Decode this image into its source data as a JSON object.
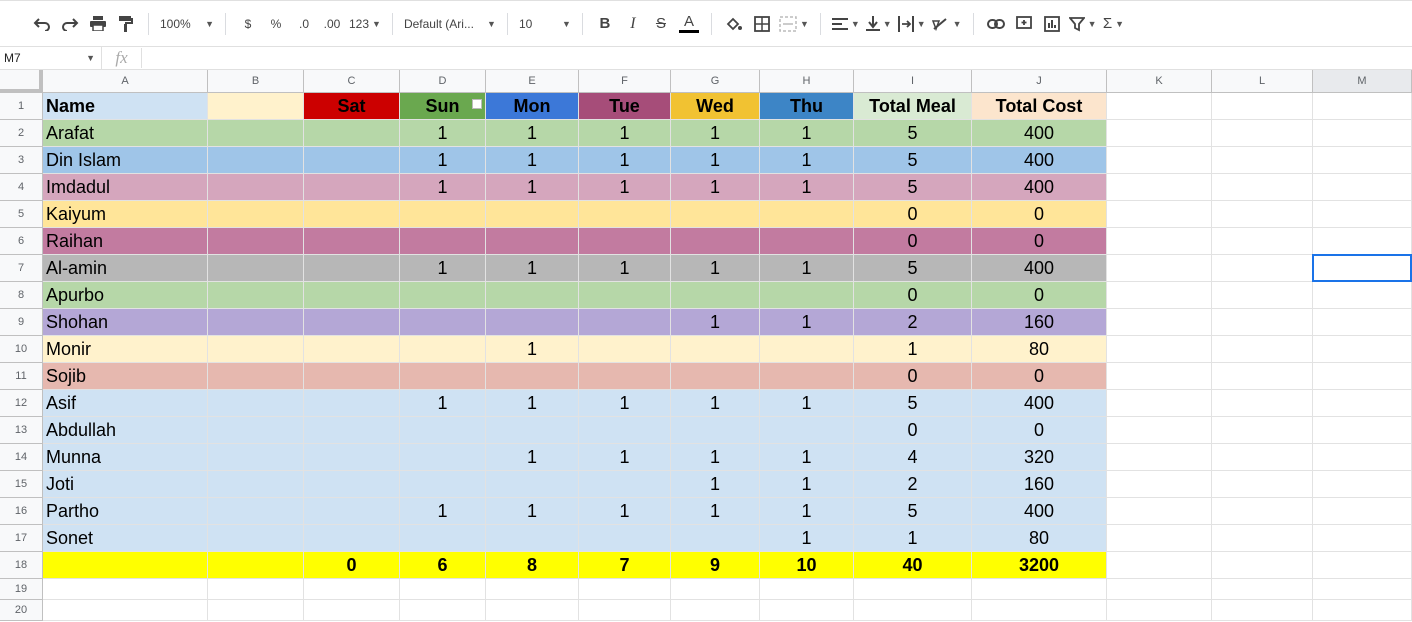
{
  "toolbar": {
    "zoom": "100%",
    "currency": "$",
    "percent": "%",
    "dec_decrease": ".0",
    "dec_increase": ".00",
    "more_formats": "123",
    "font": "Default (Ari...",
    "font_size": "10",
    "bold": "B",
    "italic": "I",
    "strike": "S",
    "text_color": "A",
    "sum": "Σ"
  },
  "formula_bar": {
    "name_box": "M7",
    "fx": "fx",
    "value": ""
  },
  "columns": [
    "A",
    "B",
    "C",
    "D",
    "E",
    "F",
    "G",
    "H",
    "I",
    "J",
    "K",
    "L",
    "M"
  ],
  "rows": [
    "1",
    "2",
    "3",
    "4",
    "5",
    "6",
    "7",
    "8",
    "9",
    "10",
    "11",
    "12",
    "13",
    "14",
    "15",
    "16",
    "17",
    "18",
    "19",
    "20"
  ],
  "header_row": [
    "Name",
    "",
    "Sat",
    "Sun",
    "Mon",
    "Tue",
    "Wed",
    "Thu",
    "Total Meal",
    "Total Cost"
  ],
  "header_colors": [
    "#cfe2f3",
    "#fff2cc",
    "#cc0000",
    "#6aa84f",
    "#3c78d8",
    "#a64d79",
    "#f1c232",
    "#3d85c6",
    "#d9ead3",
    "#fce5cd"
  ],
  "data_rows": [
    {
      "name": "Arafat",
      "color": "#b6d7a8",
      "days": [
        "",
        "1",
        "1",
        "1",
        "1",
        "1"
      ],
      "meal": "5",
      "cost": "400"
    },
    {
      "name": "Din Islam",
      "color": "#9fc5e8",
      "days": [
        "",
        "1",
        "1",
        "1",
        "1",
        "1"
      ],
      "meal": "5",
      "cost": "400"
    },
    {
      "name": "Imdadul",
      "color": "#d5a6bd",
      "days": [
        "",
        "1",
        "1",
        "1",
        "1",
        "1"
      ],
      "meal": "5",
      "cost": "400"
    },
    {
      "name": "Kaiyum",
      "color": "#ffe599",
      "days": [
        "",
        "",
        "",
        "",
        "",
        ""
      ],
      "meal": "0",
      "cost": "0"
    },
    {
      "name": "Raihan",
      "color": "#c27ba0",
      "days": [
        "",
        "",
        "",
        "",
        "",
        ""
      ],
      "meal": "0",
      "cost": "0"
    },
    {
      "name": "Al-amin",
      "color": "#b7b7b7",
      "days": [
        "",
        "1",
        "1",
        "1",
        "1",
        "1"
      ],
      "meal": "5",
      "cost": "400"
    },
    {
      "name": "Apurbo",
      "color": "#b6d7a8",
      "days": [
        "",
        "",
        "",
        "",
        "",
        ""
      ],
      "meal": "0",
      "cost": "0"
    },
    {
      "name": "Shohan",
      "color": "#b4a7d6",
      "days": [
        "",
        "",
        "",
        "",
        "1",
        "1"
      ],
      "meal": "2",
      "cost": "160"
    },
    {
      "name": "Monir",
      "color": "#fff2cc",
      "days": [
        "",
        "",
        "1",
        "",
        "",
        ""
      ],
      "meal": "1",
      "cost": "80"
    },
    {
      "name": "Sojib",
      "color": "#e6b8af",
      "days": [
        "",
        "",
        "",
        "",
        "",
        ""
      ],
      "meal": "0",
      "cost": "0"
    },
    {
      "name": "Asif",
      "color": "#cfe2f3",
      "days": [
        "",
        "1",
        "1",
        "1",
        "1",
        "1"
      ],
      "meal": "5",
      "cost": "400"
    },
    {
      "name": "Abdullah",
      "color": "#cfe2f3",
      "days": [
        "",
        "",
        "",
        "",
        "",
        ""
      ],
      "meal": "0",
      "cost": "0"
    },
    {
      "name": "Munna",
      "color": "#cfe2f3",
      "days": [
        "",
        "",
        "1",
        "1",
        "1",
        "1"
      ],
      "meal": "4",
      "cost": "320"
    },
    {
      "name": "Joti",
      "color": "#cfe2f3",
      "days": [
        "",
        "",
        "",
        "",
        "1",
        "1"
      ],
      "meal": "2",
      "cost": "160"
    },
    {
      "name": "Partho",
      "color": "#cfe2f3",
      "days": [
        "",
        "1",
        "1",
        "1",
        "1",
        "1"
      ],
      "meal": "5",
      "cost": "400"
    },
    {
      "name": "Sonet",
      "color": "#cfe2f3",
      "days": [
        "",
        "",
        "",
        "",
        "",
        "1"
      ],
      "meal": "1",
      "cost": "80"
    }
  ],
  "totals_row": [
    "",
    "",
    "0",
    "6",
    "8",
    "7",
    "9",
    "10",
    "40",
    "3200"
  ],
  "totals_color": "#ffff00",
  "selected_cell": "M7",
  "accent_color": "#1a73e8"
}
